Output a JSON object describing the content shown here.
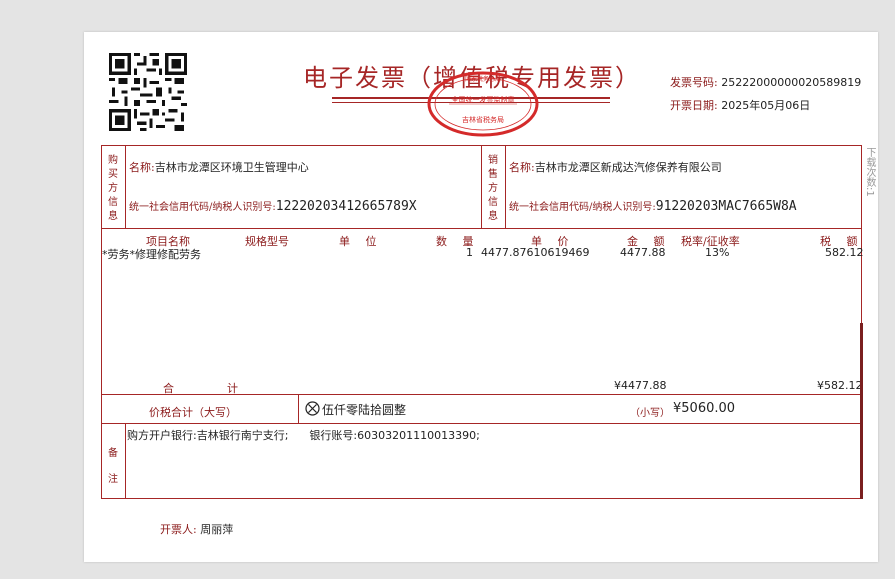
{
  "invoice": {
    "title": "电子发票（增值税专用发票）",
    "number_label": "发票号码:",
    "number": "25222000000020589819",
    "date_label": "开票日期:",
    "date": "2025年05月06日",
    "seal_text": [
      "吉林省税务局",
      "全国统一发票监制章"
    ]
  },
  "buyer": {
    "section_label": [
      "购",
      "买",
      "方",
      "信",
      "息"
    ],
    "name_label": "名称:",
    "name": "吉林市龙潭区环境卫生管理中心",
    "tax_label": "统一社会信用代码/纳税人识别号:",
    "tax_id": "12220203412665789X"
  },
  "seller": {
    "section_label": [
      "销",
      "售",
      "方",
      "信",
      "息"
    ],
    "name_label": "名称:",
    "name": "吉林市龙潭区新成达汽修保养有限公司",
    "tax_label": "统一社会信用代码/纳税人识别号:",
    "tax_id": "91220203MAC7665W8A"
  },
  "columns": {
    "item_name": "项目名称",
    "spec": "规格型号",
    "unit": "单 位",
    "qty": "数 量",
    "price": "单 价",
    "amount": "金 额",
    "rate": "税率/征收率",
    "tax": "税 额"
  },
  "items": [
    {
      "name": "*劳务*修理修配劳务",
      "qty": "1",
      "price": "4477.87610619469",
      "amount": "4477.88",
      "rate": "13%",
      "tax": "582.12"
    }
  ],
  "totals": {
    "label_he": "合",
    "label_ji": "计",
    "amount": "¥4477.88",
    "tax": "¥582.12",
    "daxie_label": "价税合计（大写）",
    "daxie_value": "伍仟零陆拾圆整",
    "xiaoxie_label": "（小写）",
    "xiaoxie_value": "¥5060.00"
  },
  "remarks": {
    "label": [
      "备",
      "注"
    ],
    "text": "购方开户银行:吉林银行南宁支行;      银行账号:60303201110013390;"
  },
  "issuer": {
    "label": "开票人:",
    "name": "周丽萍"
  },
  "side_note": "下载次数:1"
}
